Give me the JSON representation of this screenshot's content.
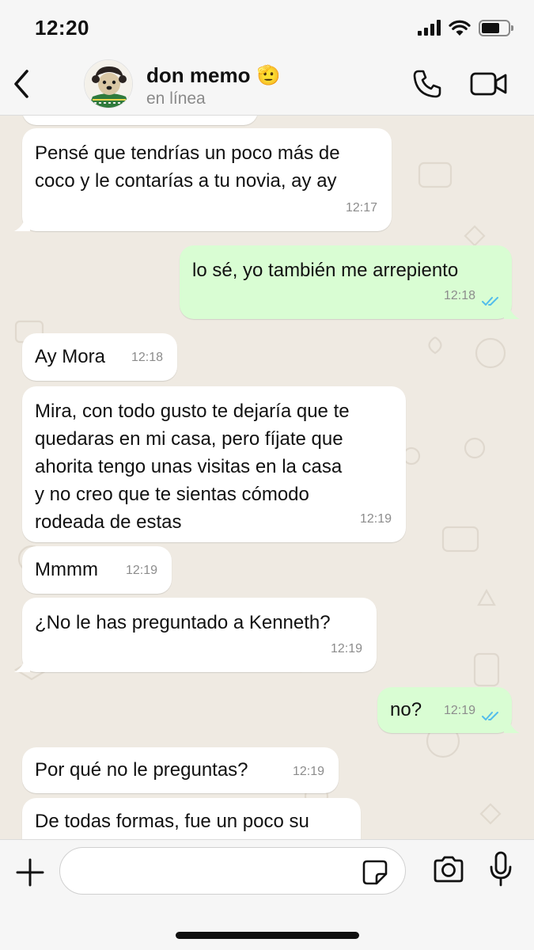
{
  "status_bar": {
    "time": "12:20"
  },
  "header": {
    "contact_name": "don memo",
    "contact_emoji": "🫡",
    "contact_status": "en línea"
  },
  "messages": [
    {
      "direction": "in",
      "text": "Pensé que tendrías un poco más de\ncoco y le contarías a tu novia, ay ay",
      "time": "12:17"
    },
    {
      "direction": "out",
      "text": "lo sé, yo también me arrepiento",
      "time": "12:18",
      "read": true
    },
    {
      "direction": "in",
      "text": "Ay Mora",
      "time": "12:18"
    },
    {
      "direction": "in",
      "text": "Mira, con todo gusto te dejaría que te\nquedaras en mi casa, pero fíjate que\nahorita tengo unas visitas en la casa\ny no creo que te sientas cómodo\nrodeada de estas",
      "time": "12:19"
    },
    {
      "direction": "in",
      "text": "Mmmm",
      "time": "12:19"
    },
    {
      "direction": "in",
      "text": "¿No le has preguntado a Kenneth?",
      "time": "12:19"
    },
    {
      "direction": "out",
      "text": "no?",
      "time": "12:19",
      "read": true
    },
    {
      "direction": "in",
      "text": "Por qué no le preguntas?",
      "time": "12:19"
    },
    {
      "direction": "in",
      "text": "De todas formas, fue un poco su",
      "time": ""
    }
  ],
  "input": {
    "value": "",
    "placeholder": ""
  },
  "colors": {
    "header_bg": "#f6f6f6",
    "chat_bg": "#efeae2",
    "incoming_bubble": "#ffffff",
    "outgoing_bubble": "#d9fdd3",
    "read_ticks": "#53bdeb"
  },
  "icons": {
    "back": "chevron-left-icon",
    "call": "phone-icon",
    "video": "video-camera-icon",
    "attach": "plus-icon",
    "sticker": "sticker-icon",
    "camera": "camera-icon",
    "mic": "microphone-icon"
  }
}
